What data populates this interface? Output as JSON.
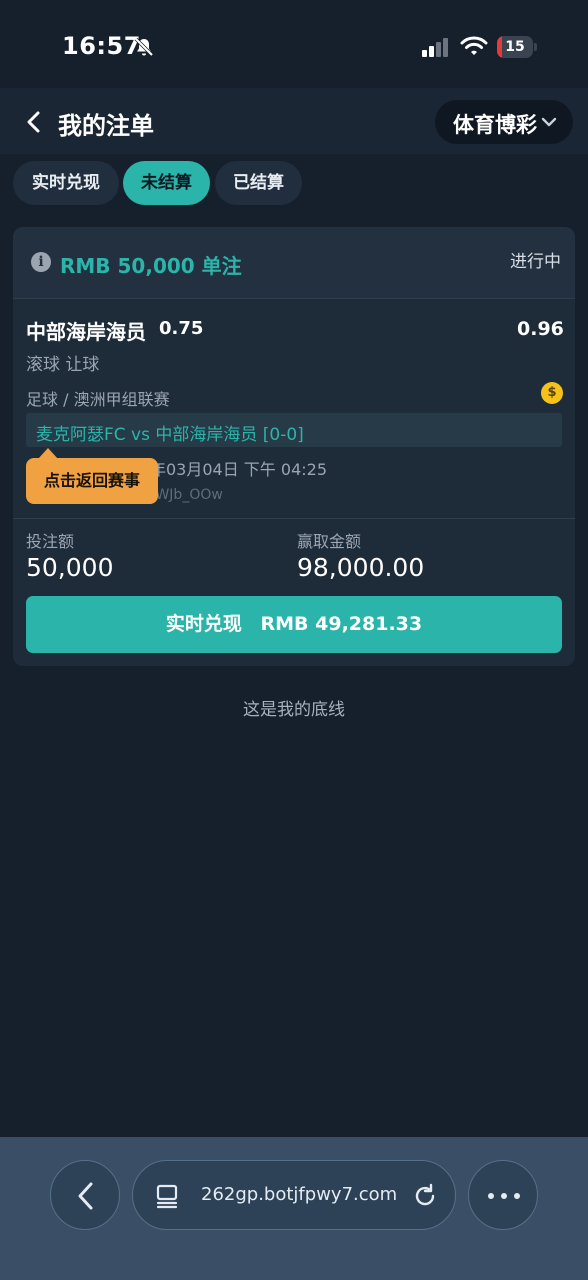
{
  "status_bar": {
    "time": "16:57",
    "battery_level": "15",
    "icons": [
      "bell-slash-icon",
      "signal-icon",
      "wifi-icon",
      "battery-icon"
    ]
  },
  "header": {
    "title": "我的注单",
    "dropdown_label": "体育博彩"
  },
  "tabs": [
    {
      "label": "实时兑现",
      "active": false
    },
    {
      "label": "未结算",
      "active": true
    },
    {
      "label": "已结算",
      "active": false
    }
  ],
  "bet_card": {
    "stake_title": "RMB 50,000 单注",
    "status": "进行中",
    "selection": "中部海岸海员",
    "handicap": "0.75",
    "odds": "0.96",
    "market": "滚球 让球",
    "league": "足球 / 澳洲甲组联赛",
    "match": "麦克阿瑟FC vs 中部海岸海员 [0-0]",
    "datetime": "年03月04日 下午 04:25",
    "bet_id": "(WJb_OOw",
    "tooltip": "点击返回赛事",
    "stake_label": "投注额",
    "stake_value": "50,000",
    "win_label": "赢取金额",
    "win_value": "98,000.00",
    "cashout_label": "实时兑现",
    "cashout_amount": "RMB 49,281.33"
  },
  "footer_text": "这是我的底线",
  "browser": {
    "url": "262gp.botjfpwy7.com"
  },
  "colors": {
    "background": "#16202c",
    "accent": "#2bb5aa",
    "tooltip": "#f0a243",
    "card": "#1e2b39"
  }
}
